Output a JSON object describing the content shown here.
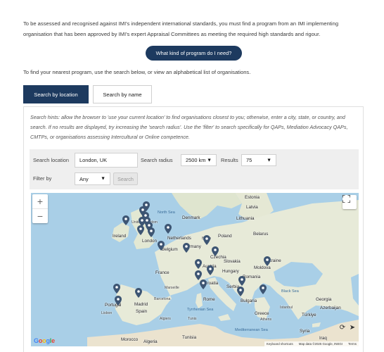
{
  "intro_text": "To be assessed and recognised against IMI's independent international standards, you must find a program from an IMI implementing organisation that has been approved by IMI's expert Appraisal Committees as meeting the required high standards and rigour.",
  "cta_label": "What kind of program do I need?",
  "find_text": "To find your nearest program, use the search below, or view an alphabetical list of organisations.",
  "tabs": [
    {
      "label": "Search by location",
      "active": true
    },
    {
      "label": "Search by name",
      "active": false
    }
  ],
  "hints": "Search hints: allow the browser to 'use your current location' to find organisations closest to you; otherwise, enter a city, state, or country, and search. If no results are displayed, try increasing the 'search radius'. Use the 'filter' to search specifically for QAPs, Mediation Advocacy QAPs, CMTPs, or organisations assessing Intercultural or Online competence.",
  "search": {
    "location_label": "Search location",
    "location_value": "London, UK",
    "radius_label": "Search radius",
    "radius_value": "2500 km",
    "results_label": "Results",
    "results_value": "75",
    "filter_label": "Filter by",
    "filter_value": "Any",
    "search_button": "Search"
  },
  "map": {
    "zoom_in": "+",
    "zoom_out": "−",
    "google": "Google",
    "attribution": {
      "shortcuts": "Keyboard shortcuts",
      "data": "Map data ©2025 Google, INEGI",
      "terms": "Terms"
    },
    "places": {
      "estonia": "Estonia",
      "latvia": "Latvia",
      "north_sea": "North Sea",
      "denmark": "Denmark",
      "lithuania": "Lithuania",
      "united_kingdom": "United Kingdom",
      "ireland": "Ireland",
      "london": "London",
      "netherlands": "Netherlands",
      "berlin": "Berlin",
      "poland": "Poland",
      "belarus": "Belarus",
      "belgium": "Belgium",
      "germany": "Germany",
      "czechia": "Czechia",
      "ukraine": "Ukraine",
      "slovakia": "Slovakia",
      "moldova": "Moldova",
      "france": "France",
      "austria": "Austria",
      "hungary": "Hungary",
      "romania": "Romania",
      "croatia": "Croatia",
      "serbia": "Serbia",
      "black_sea": "Black Sea",
      "marseille": "Marseille",
      "rome": "Rome",
      "bulgaria": "Bulgaria",
      "portugal": "Portugal",
      "madrid": "Madrid",
      "spain": "Spain",
      "barcelona": "Barcelona",
      "georgia": "Georgia",
      "istanbul": "Istanbul",
      "azerbaijan": "Azerbaijan",
      "lisbon": "Lisbon",
      "tyrrhenian_sea": "Tyrrhenian Sea",
      "greece": "Greece",
      "turkiye": "Türkiye",
      "athens": "Athens",
      "algiers": "Algiers",
      "tunis": "Tunis",
      "syria": "Syria",
      "morocco": "Morocco",
      "tunisia": "Tunisia",
      "algeria": "Algeria",
      "mediterranean": "Mediterranean Sea",
      "iraq": "Iraq"
    }
  },
  "colors": {
    "primary": "#1d3a5f",
    "pin": "#3d5573",
    "water": "#a9cfe7",
    "land": "#e7ead8"
  }
}
